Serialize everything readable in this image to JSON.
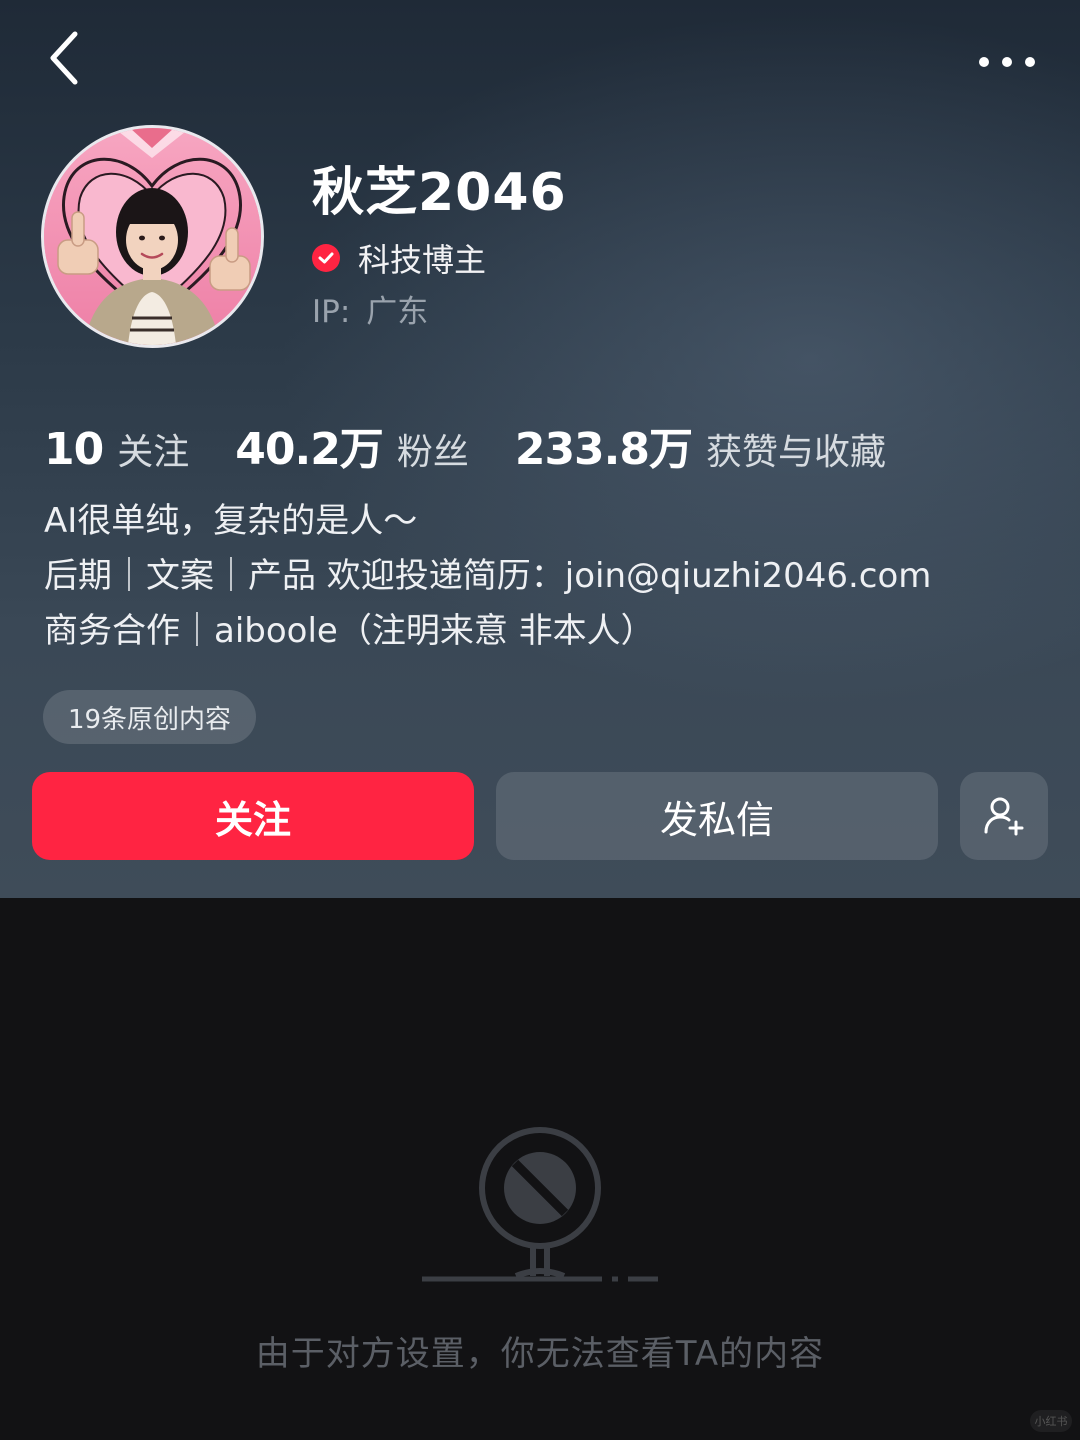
{
  "nav": {
    "back_icon": "chevron-left-icon",
    "more_icon": "more-horizontal-icon"
  },
  "profile": {
    "username": "秋芝2046",
    "verified_label": "科技博主",
    "ip_label": "IP:",
    "ip_region": "广东"
  },
  "stats": [
    {
      "value": "10",
      "label": "关注"
    },
    {
      "value": "40.2万",
      "label": "粉丝"
    },
    {
      "value": "233.8万",
      "label": "获赞与收藏"
    }
  ],
  "bio": {
    "lines": [
      "AI很单纯，复杂的是人～",
      "后期｜文案｜产品 欢迎投递简历：join@qiuzhi2046.com",
      "商务合作｜aiboole（注明来意 非本人）"
    ]
  },
  "original_badge": "19条原创内容",
  "actions": {
    "follow_label": "关注",
    "message_label": "发私信",
    "add_friend_icon": "add-user-icon"
  },
  "blocked": {
    "message": "由于对方设置，你无法查看TA的内容",
    "icon": "blocked-camera-icon"
  },
  "watermark": "小红书",
  "colors": {
    "accent": "#ff2442",
    "header_bg": "#2f3d4b",
    "page_bg": "#121214"
  }
}
